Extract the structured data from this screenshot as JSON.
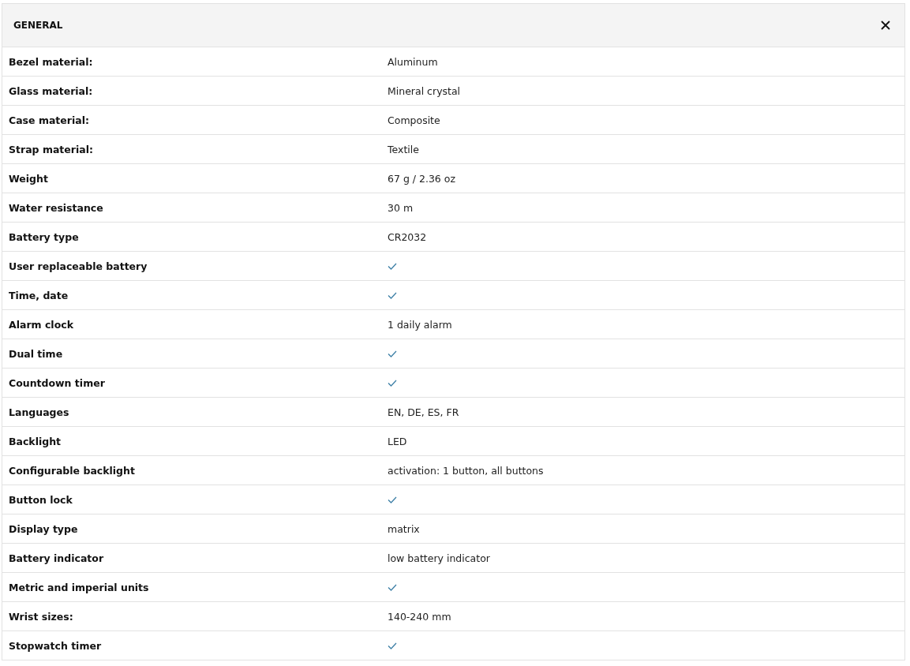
{
  "panel": {
    "title": "GENERAL"
  },
  "rows": [
    {
      "label": "Bezel material:",
      "kind": "text",
      "value": "Aluminum"
    },
    {
      "label": "Glass material:",
      "kind": "text",
      "value": "Mineral crystal"
    },
    {
      "label": "Case material:",
      "kind": "text",
      "value": "Composite"
    },
    {
      "label": "Strap material:",
      "kind": "text",
      "value": "Textile"
    },
    {
      "label": "Weight",
      "kind": "text",
      "value": "67 g / 2.36 oz"
    },
    {
      "label": "Water resistance",
      "kind": "text",
      "value": "30 m"
    },
    {
      "label": "Battery type",
      "kind": "text",
      "value": "CR2032"
    },
    {
      "label": "User replaceable battery",
      "kind": "check"
    },
    {
      "label": "Time, date",
      "kind": "check"
    },
    {
      "label": "Alarm clock",
      "kind": "text",
      "value": "1 daily alarm"
    },
    {
      "label": "Dual time",
      "kind": "check"
    },
    {
      "label": "Countdown timer",
      "kind": "check"
    },
    {
      "label": "Languages",
      "kind": "text",
      "value": "EN, DE, ES, FR"
    },
    {
      "label": "Backlight",
      "kind": "text",
      "value": "LED"
    },
    {
      "label": "Configurable backlight",
      "kind": "text",
      "value": "activation: 1 button, all buttons"
    },
    {
      "label": "Button lock",
      "kind": "check"
    },
    {
      "label": "Display type",
      "kind": "text",
      "value": "matrix"
    },
    {
      "label": "Battery indicator",
      "kind": "text",
      "value": "low battery indicator"
    },
    {
      "label": "Metric and imperial units",
      "kind": "check"
    },
    {
      "label": "Wrist sizes:",
      "kind": "text",
      "value": "140-240 mm"
    },
    {
      "label": "Stopwatch timer",
      "kind": "check"
    }
  ]
}
